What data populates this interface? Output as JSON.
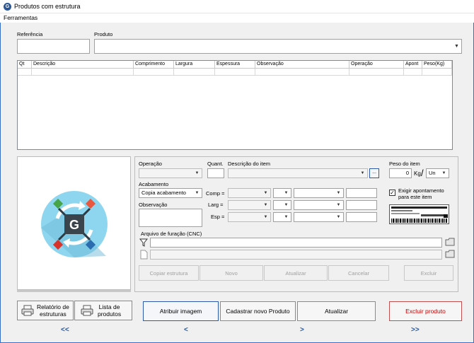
{
  "window": {
    "title": "Produtos com estrutura",
    "app_icon_letter": "G"
  },
  "menu": {
    "items": [
      "Ferramentas"
    ]
  },
  "header": {
    "referencia_label": "Referência",
    "produto_label": "Produto",
    "referencia_value": "",
    "produto_value": ""
  },
  "grid": {
    "columns": [
      "Qt",
      "Descrição",
      "Comprimento",
      "Largura",
      "Espessura",
      "Observação",
      "Operação",
      "Apont",
      "Peso(Kg)"
    ]
  },
  "logo": {
    "letter": "G"
  },
  "item_form": {
    "operacao_label": "Operação",
    "quant_label": "Quant.",
    "descricao_label": "Descrição do item",
    "descricao_btn": "...",
    "peso_label": "Peso do item",
    "peso_value": "0",
    "peso_unit_label": "Kg",
    "peso_slash": "/",
    "unit_value": "Un",
    "acabamento_label": "Acabamento",
    "acabamento_value": "Copia acabamento",
    "observacao_label": "Observação",
    "comp_label": "Comp =",
    "larg_label": "Larg =",
    "esp_label": "Esp =",
    "exigir_label_line1": "Exigir apontamento",
    "exigir_label_line2": "para este item",
    "exigir_checked": "✓",
    "arquivo_label": "Arquivo de furação (CNC)"
  },
  "item_buttons": {
    "copiar": "Copiar estrutura",
    "novo": "Novo",
    "atualizar": "Atualizar",
    "cancelar": "Cancelar",
    "excluir": "Excluir"
  },
  "bottom": {
    "relatorio_line1": "Relatório de",
    "relatorio_line2": "estruturas",
    "lista_line1": "Lista de",
    "lista_line2": "produtos",
    "atribuir": "Atribuir imagem",
    "cadastrar": "Cadastrar novo Produto",
    "atualizar": "Atualizar",
    "excluir_produto": "Excluir produto"
  },
  "nav": {
    "first": "<<",
    "prev": "<",
    "next": ">",
    "last": ">>"
  },
  "colors": {
    "accent": "#2f5aa8",
    "danger": "#c00000",
    "nav": "#2b5797"
  }
}
